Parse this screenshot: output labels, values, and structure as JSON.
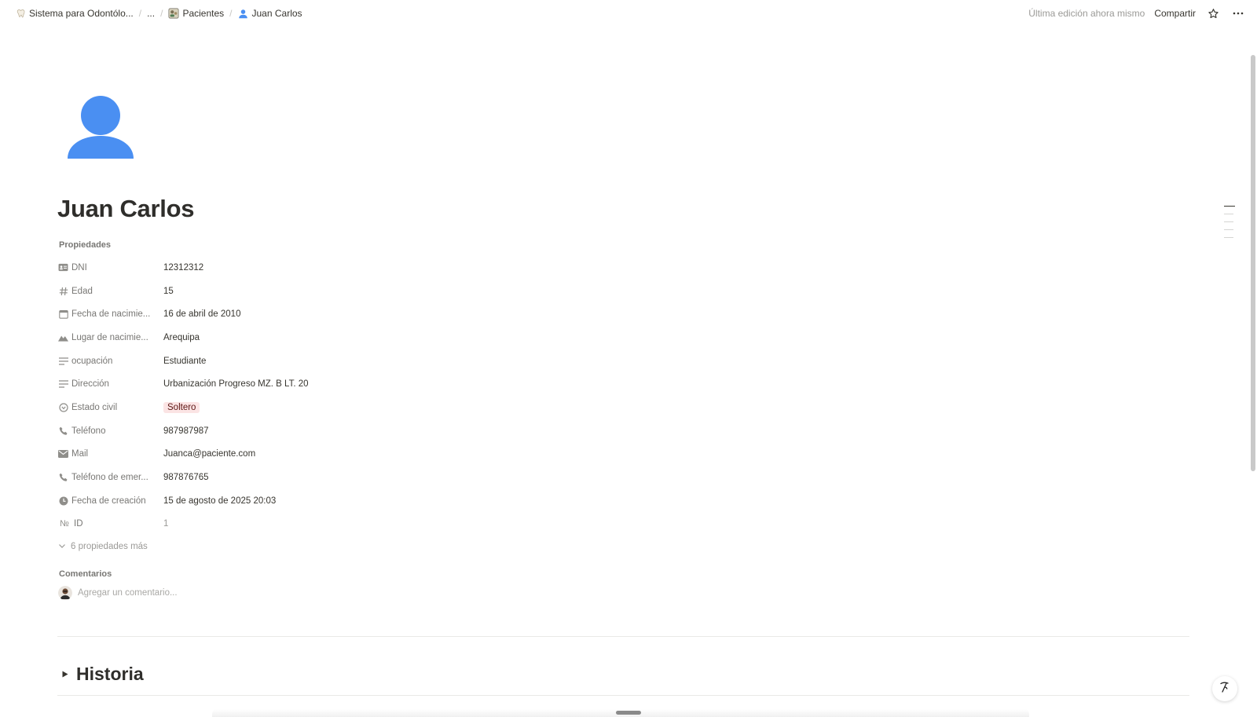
{
  "breadcrumb": {
    "items": [
      {
        "label": "Sistema para Odontólo...",
        "icon": "tooth-icon"
      },
      {
        "label": "...",
        "icon": ""
      },
      {
        "label": "Pacientes",
        "icon": "patients-database-icon"
      },
      {
        "label": "Juan Carlos",
        "icon": "person-icon"
      }
    ]
  },
  "topbar": {
    "last_edit": "Última edición ahora mismo",
    "share_label": "Compartir"
  },
  "page": {
    "title": "Juan Carlos",
    "icon": "person-icon",
    "icon_color": "#4a8ff2"
  },
  "properties": {
    "heading": "Propiedades",
    "rows": [
      {
        "name": "DNI",
        "icon": "id-card-icon",
        "value": "12312312"
      },
      {
        "name": "Edad",
        "icon": "hash-icon",
        "value": "15"
      },
      {
        "name": "Fecha de nacimie...",
        "icon": "calendar-icon",
        "value": "16 de abril de 2010"
      },
      {
        "name": "Lugar de nacimie...",
        "icon": "mountain-icon",
        "value": "Arequipa"
      },
      {
        "name": "ocupación",
        "icon": "text-lines-icon",
        "value": "Estudiante"
      },
      {
        "name": "Dirección",
        "icon": "text-lines-icon",
        "value": "Urbanización Progreso MZ. B LT. 20"
      },
      {
        "name": "Estado civil",
        "icon": "status-icon",
        "value": "Soltero",
        "tag_color": "#fbe4e4"
      },
      {
        "name": "Teléfono",
        "icon": "phone-icon",
        "value": "987987987"
      },
      {
        "name": "Mail",
        "icon": "mail-icon",
        "value": "Juanca@paciente.com"
      },
      {
        "name": "Teléfono de emer...",
        "icon": "phone-icon",
        "value": "987876765"
      },
      {
        "name": "Fecha de creación",
        "icon": "clock-icon",
        "value": "15 de agosto de 2025 20:03"
      },
      {
        "name": "ID",
        "icon": "number-sign-icon",
        "icon_text": "№",
        "value": "1"
      }
    ],
    "more_label": "6 propiedades más"
  },
  "comments": {
    "heading": "Comentarios",
    "placeholder": "Agregar un comentario..."
  },
  "sections": {
    "historia": "Historia"
  }
}
